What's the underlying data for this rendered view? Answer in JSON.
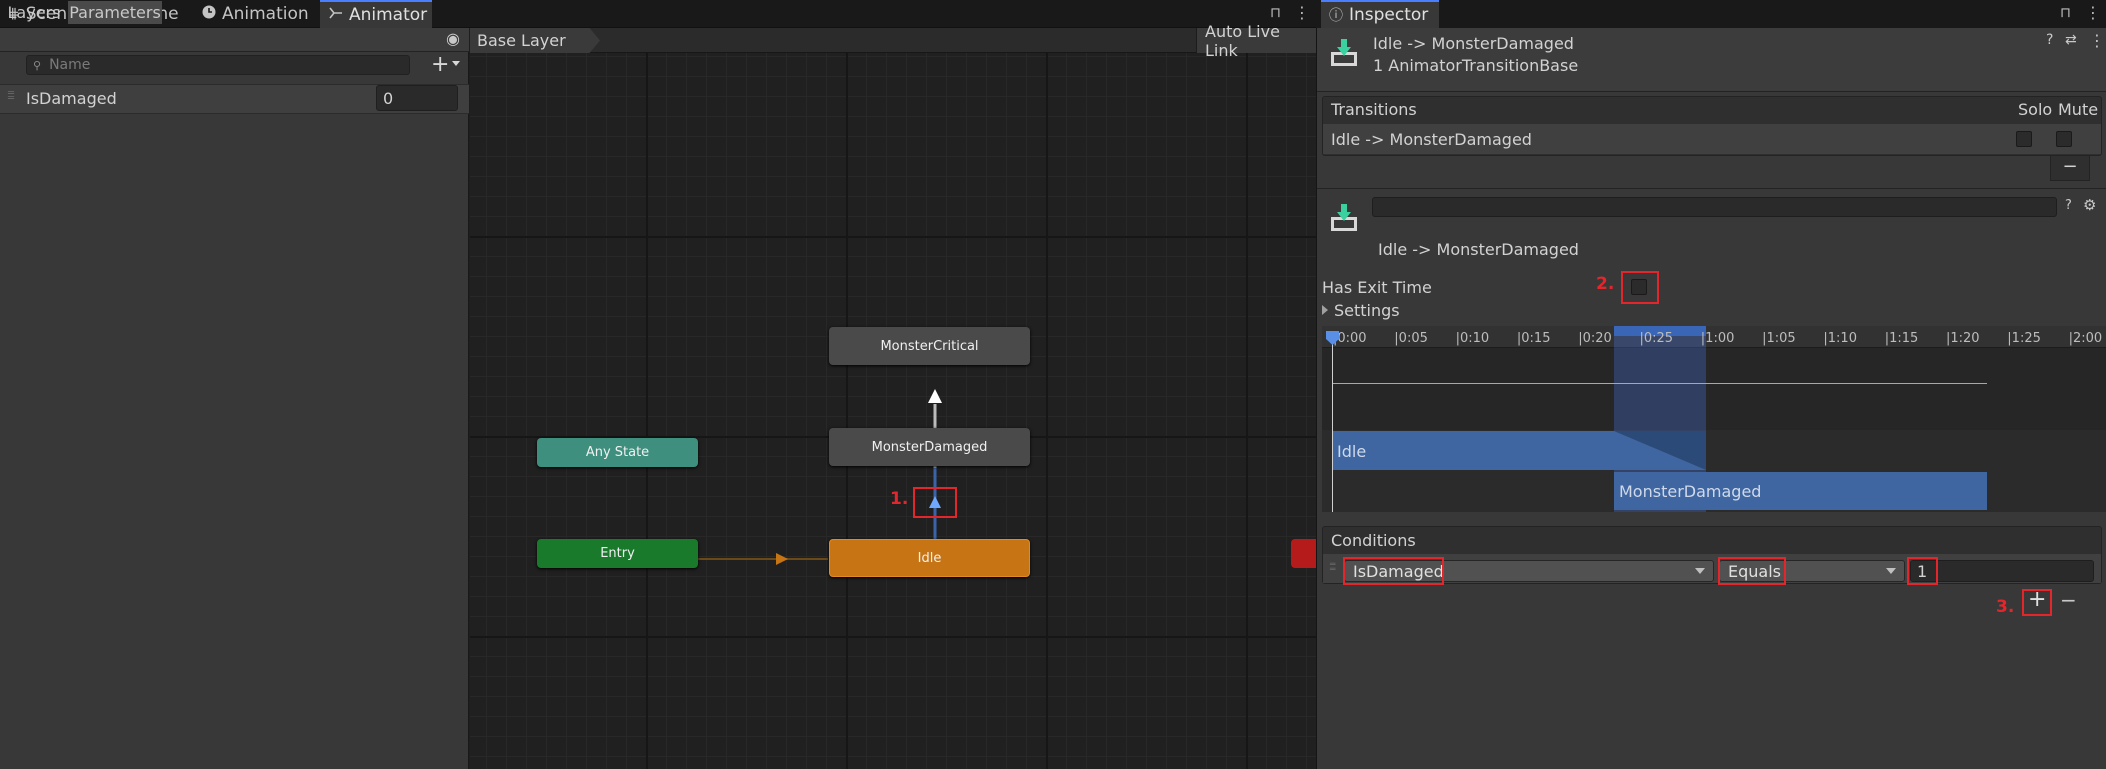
{
  "tabs": [
    {
      "label": "Scene",
      "icon": "grid-icon"
    },
    {
      "label": "Game",
      "icon": "gamepad-icon"
    },
    {
      "label": "Animation",
      "icon": "clock-icon"
    },
    {
      "label": "Animator",
      "icon": "animator-icon",
      "active": true
    }
  ],
  "left": {
    "tabs": [
      "Layers",
      "Parameters"
    ],
    "search_placeholder": "Name",
    "parameters": [
      {
        "name": "IsDamaged",
        "value": "0"
      }
    ]
  },
  "graph": {
    "breadcrumb": "Base Layer",
    "auto_live_link": "Auto Live Link",
    "nodes": {
      "critical": "MonsterCritical",
      "damaged": "MonsterDamaged",
      "idle": "Idle",
      "any": "Any State",
      "entry": "Entry"
    },
    "annotation1": "1."
  },
  "inspector": {
    "tab": "Inspector",
    "title": "Idle -> MonsterDamaged",
    "subtitle": "1 AnimatorTransitionBase",
    "transitions_header": "Transitions",
    "solo": "Solo",
    "mute": "Mute",
    "transition_row": "Idle -> MonsterDamaged",
    "minus": "−",
    "detail_title": "Idle -> MonsterDamaged",
    "has_exit_time": "Has Exit Time",
    "has_exit_time_checked": false,
    "settings": "Settings",
    "annotation2": "2.",
    "timeline_ticks": [
      "0:00",
      "0:05",
      "0:10",
      "0:15",
      "0:20",
      "0:25",
      "1:00",
      "1:05",
      "1:10",
      "1:15",
      "1:20",
      "1:25",
      "2:00"
    ],
    "idle_bar": "Idle",
    "damaged_bar": "MonsterDamaged",
    "conditions_header": "Conditions",
    "condition": {
      "parameter": "IsDamaged",
      "mode": "Equals",
      "value": "1"
    },
    "plus": "+",
    "annotation3": "3."
  },
  "colors": {
    "accent": "#4c7fff",
    "idle": "#c77514",
    "entry": "#1a7a2c",
    "any": "#3f8f7f",
    "annotation": "#e3262b"
  }
}
